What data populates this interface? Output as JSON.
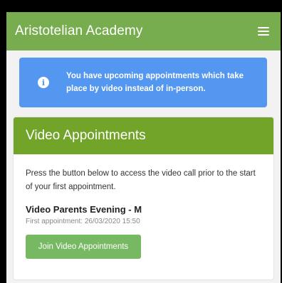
{
  "header": {
    "title": "Aristotelian Academy",
    "menu_icon": "hamburger-menu-icon",
    "color": "#77ad4e"
  },
  "alert": {
    "icon": "info-icon",
    "message": "You have upcoming appointments which take place by video instead of in-person.",
    "color": "#5397f0"
  },
  "card": {
    "title": "Video Appointments",
    "description": "Press the button below to access the video call prior to the start of your first appointment.",
    "event_title": "Video Parents Evening - M",
    "first_appointment": "First appointment: 26/03/2020 15:50",
    "join_label": "Join Video Appointments",
    "header_color": "#72a42a",
    "button_color": "#77b862"
  }
}
